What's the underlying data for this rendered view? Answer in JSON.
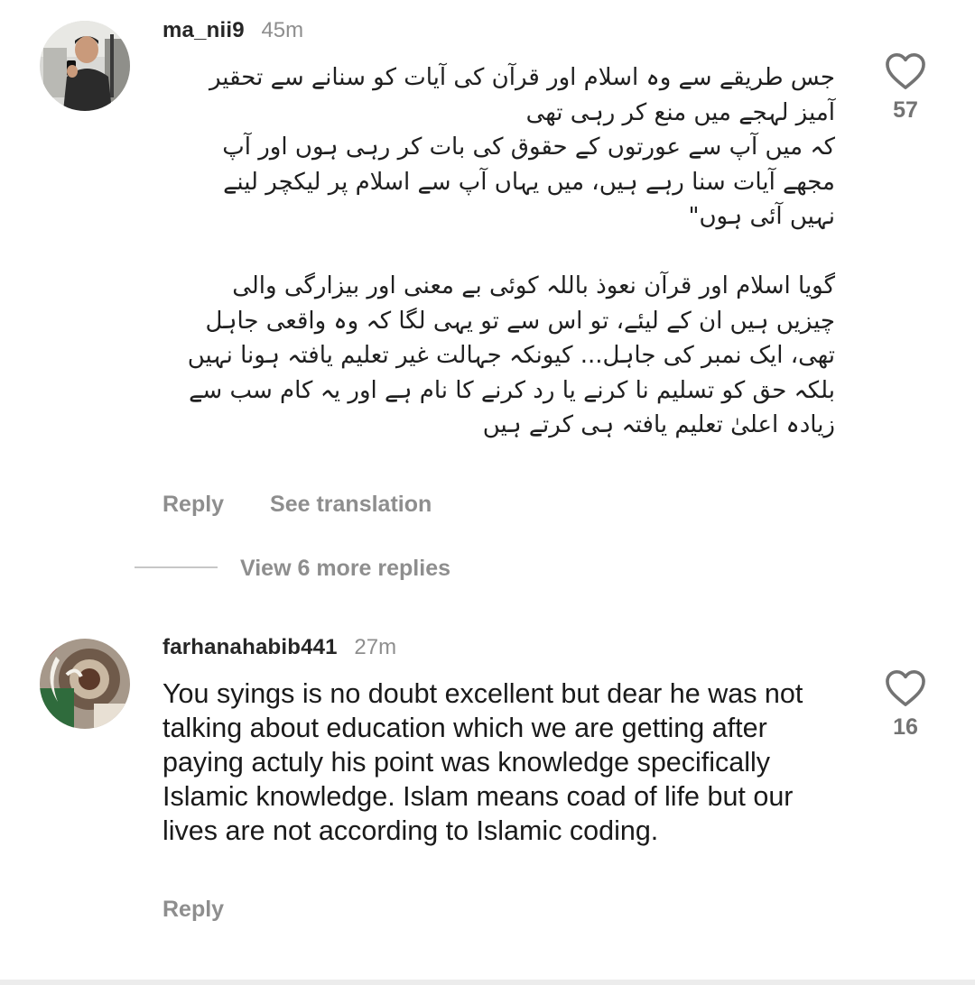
{
  "comments": [
    {
      "username": "ma_nii9",
      "time": "45m",
      "text_lines": [
        "جس طریقے سے وہ اسلام اور قرآن کی آیات کو سنانے سے تحقیر",
        "آمیز لہجے میں منع کر رہی تھی",
        "کہ میں آپ سے عورتوں کے حقوق کی بات کر رہی ہوں اور آپ",
        "مجھے آیات سنا رہے ہیں، میں یہاں آپ سے اسلام پر لیکچر لینے",
        "نہیں آئی ہوں\"",
        "گویا اسلام اور قرآن نعوذ باللہ کوئی بے معنی اور بیزارگی والی",
        "چیزیں ہیں ان کے لیئے، تو اس سے تو یہی لگا کہ وہ واقعی جاہل",
        "تھی، ایک نمبر کی جاہل... کیونکہ جہالت غیر تعلیم یافتہ ہونا نہیں",
        "بلکہ حق کو تسلیم نا کرنے یا رد کرنے کا نام ہے اور یہ کام سب سے",
        "زیادہ اعلیٰ تعلیم یافتہ ہی کرتے ہیں"
      ],
      "likes": "57",
      "reply_label": "Reply",
      "translate_label": "See translation",
      "view_replies_label": "View 6 more replies"
    },
    {
      "username": "farhanahabib441",
      "time": "27m",
      "text": "You syings is no doubt  excellent but dear he was not talking about  education  which we are getting after paying actuly his point was knowledge specifically Islamic knowledge.  Islam means coad of life but our lives are not according to Islamic coding.",
      "likes": "16",
      "reply_label": "Reply"
    }
  ],
  "icons": {
    "like": "heart-outline-icon"
  },
  "colors": {
    "primary_text": "#262626",
    "secondary_text": "#8e8e8e",
    "background": "#ffffff"
  }
}
